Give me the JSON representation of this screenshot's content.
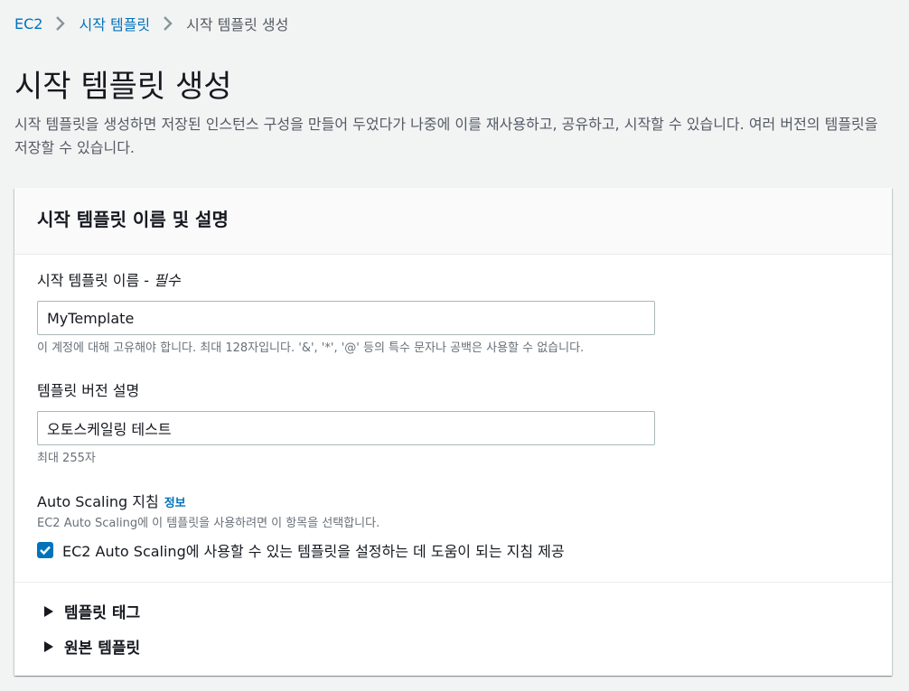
{
  "breadcrumb": {
    "items": [
      "EC2",
      "시작 템플릿",
      "시작 템플릿 생성"
    ]
  },
  "header": {
    "title": "시작 템플릿 생성",
    "description": "시작 템플릿을 생성하면 저장된 인스턴스 구성을 만들어 두었다가 나중에 이를 재사용하고, 공유하고, 시작할 수 있습니다. 여러 버전의 템플릿을 저장할 수 있습니다."
  },
  "panel": {
    "title": "시작 템플릿 이름 및 설명",
    "name_field": {
      "label": "시작 템플릿 이름 - ",
      "required": "필수",
      "value": "MyTemplate",
      "hint": "이 계정에 대해 고유해야 합니다. 최대 128자입니다. '&', '*', '@' 등의 특수 문자나 공백은 사용할 수 없습니다."
    },
    "version_field": {
      "label": "템플릿 버전 설명",
      "value": "오토스케일링 테스트",
      "hint": "최대 255자"
    },
    "autoscaling": {
      "label": "Auto Scaling 지침",
      "info": "정보",
      "hint": "EC2 Auto Scaling에 이 템플릿을 사용하려면 이 항목을 선택합니다.",
      "checkbox_label": "EC2 Auto Scaling에 사용할 수 있는 템플릿을 설정하는 데 도움이 되는 지침 제공",
      "checked": true
    },
    "expanders": [
      "템플릿 태그",
      "원본 템플릿"
    ]
  },
  "colors": {
    "accent": "#0073bb",
    "background": "#f2f3f3",
    "text": "#16191f",
    "muted": "#545b64"
  }
}
